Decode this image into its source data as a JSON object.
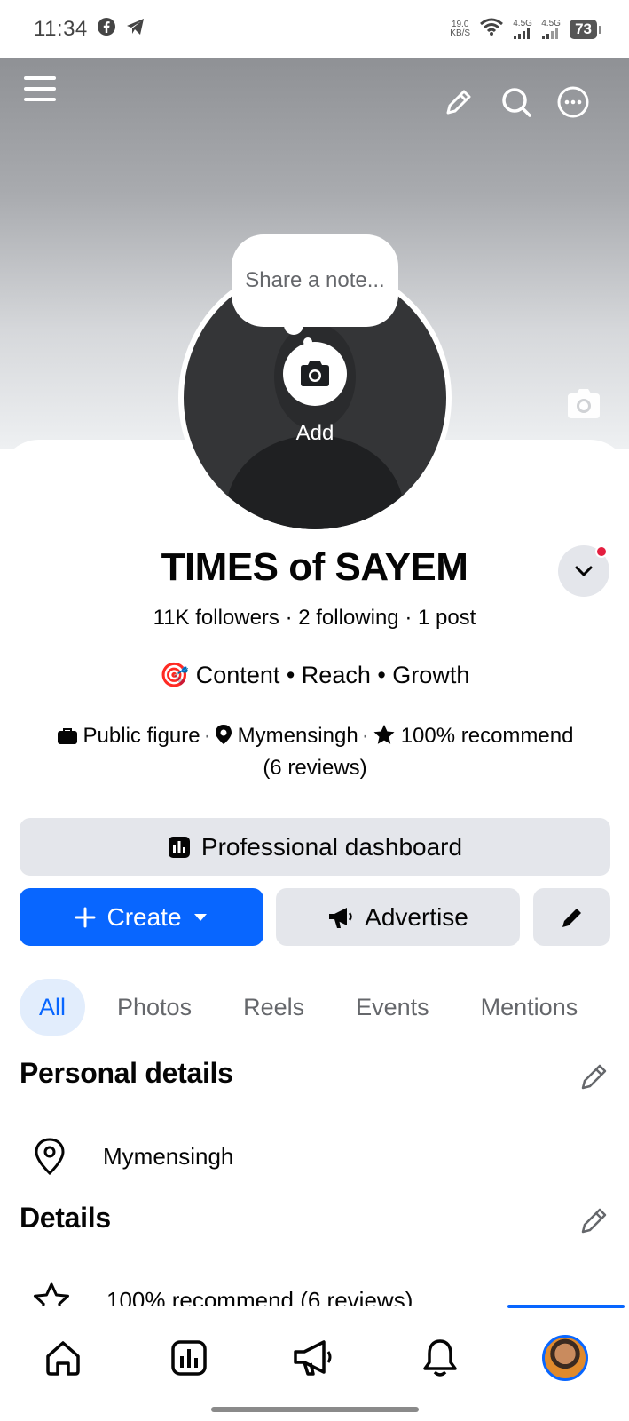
{
  "status_bar": {
    "time": "11:34",
    "net_speed_value": "19.0",
    "net_speed_unit": "KB/S",
    "sim1": "4.5G",
    "sim2": "4.5G",
    "battery": "73"
  },
  "profile": {
    "note_placeholder": "Share a note...",
    "add_photo_label": "Add",
    "name": "TIMES of SAYEM",
    "stats": "11K followers · 2 following · 1 post",
    "bio_emoji": "🎯",
    "bio": "Content • Reach • Growth",
    "category": "Public figure",
    "location": "Mymensingh",
    "recommend": "100% recommend (6 reviews)"
  },
  "actions": {
    "dashboard_label": "Professional dashboard",
    "create_label": "Create",
    "advertise_label": "Advertise"
  },
  "tabs": [
    {
      "label": "All",
      "active": true
    },
    {
      "label": "Photos",
      "active": false
    },
    {
      "label": "Reels",
      "active": false
    },
    {
      "label": "Events",
      "active": false
    },
    {
      "label": "Mentions",
      "active": false
    }
  ],
  "personal_details": {
    "title": "Personal details",
    "location": "Mymensingh"
  },
  "details": {
    "title": "Details",
    "recommend_row": "100% recommend (6 reviews)"
  },
  "nav": [
    "home-icon",
    "dashboard-icon",
    "megaphone-icon",
    "bell-icon",
    "profile-avatar"
  ],
  "colors": {
    "accent": "#0866ff",
    "tab_active_bg": "#e2edfc",
    "button_gray": "#e4e6eb",
    "notification_dot": "#e41e3f"
  }
}
